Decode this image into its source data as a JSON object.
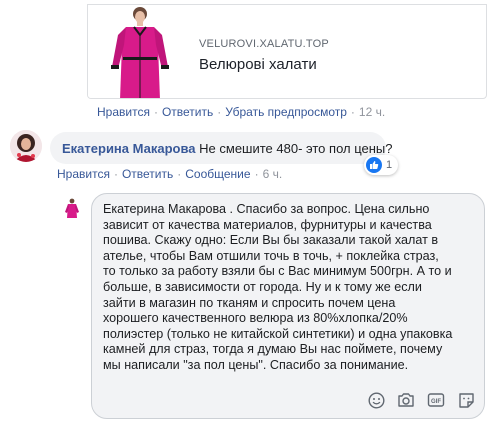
{
  "link_preview": {
    "domain": "VELUROVI.XALATU.TOP",
    "title": "Велюрові халати"
  },
  "post_actions": {
    "like": "Нравится",
    "reply": "Ответить",
    "remove_preview": "Убрать предпросмотр",
    "time": "12 ч."
  },
  "comment": {
    "author": "Екатерина Макарова",
    "text": "Не смешите 480- это пол цены?",
    "reaction_count": "1",
    "actions": {
      "like": "Нравится",
      "reply": "Ответить",
      "message": "Сообщение",
      "time": "6 ч."
    }
  },
  "reply_composer": {
    "text": "Екатерина Макарова . Спасибо  за  вопрос. Цена сильно\nзависит от качества материалов, фурнитуры и качества\nпошива. Скажу одно: Если Вы бы заказали такой халат в\nателье, чтобы Вам отшили точь в точь, + поклейка страз,\nто только за работу взяли бы с Вас минимум 500грн. А то и\nбольше, в зависимости от города. Ну и к тому же если\nзайти в магазин по тканям и спросить почем цена\nхорошего качественного велюра из 80%хлопка/20%\nполиэстер (только не китайской синтетики) и одна упаковка\n камней  для страз, тогда я думаю Вы нас поймете, почему\nмы написали \"за пол цены\". Спасибо за понимание.",
    "icons": [
      "emoji-icon",
      "camera-icon",
      "gif-icon",
      "sticker-icon"
    ]
  },
  "colors": {
    "link": "#385898",
    "meta": "#90949c",
    "bubble": "#f2f3f5",
    "like_blue": "#1877f2",
    "robe_pink": "#d81b8a"
  }
}
